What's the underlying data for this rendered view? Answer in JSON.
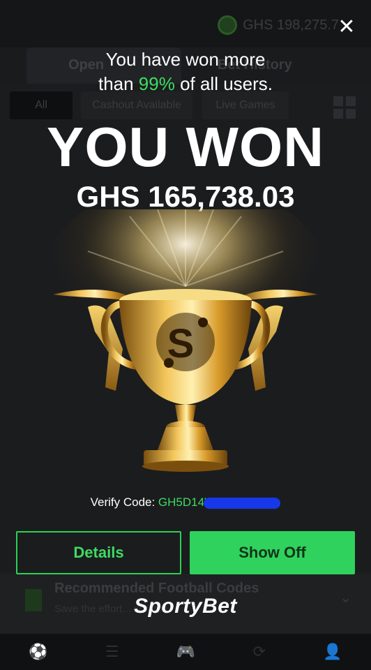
{
  "background": {
    "balance": "GHS 198,275.7",
    "tabs": [
      "Open",
      "Bet History"
    ],
    "filters": [
      "All",
      "Cashout Available",
      "Live Games"
    ],
    "recommended": {
      "title": "Recommended Football Codes",
      "subtitle": "Save the effort... scratch"
    }
  },
  "popup": {
    "close_symbol": "✕",
    "line1": "You have won more",
    "line2_prefix": "than ",
    "line2_percent": "99%",
    "line2_suffix": " of all users.",
    "you_won": "YOU WON",
    "amount": "GHS 165,738.03",
    "verify_label": "Verify Code: ",
    "verify_code": "GH5D14V",
    "details_label": "Details",
    "show_off_label": "Show Off",
    "brand": "SportyBet"
  },
  "colors": {
    "accent_green": "#3ddc62",
    "button_green": "#2fd25c",
    "redaction_blue": "#1738e8"
  },
  "icons": {
    "close": "close-icon",
    "trophy": "trophy-icon",
    "nav": [
      "football-icon",
      "list-icon",
      "gamepad-icon",
      "refresh-icon",
      "user-icon"
    ]
  }
}
